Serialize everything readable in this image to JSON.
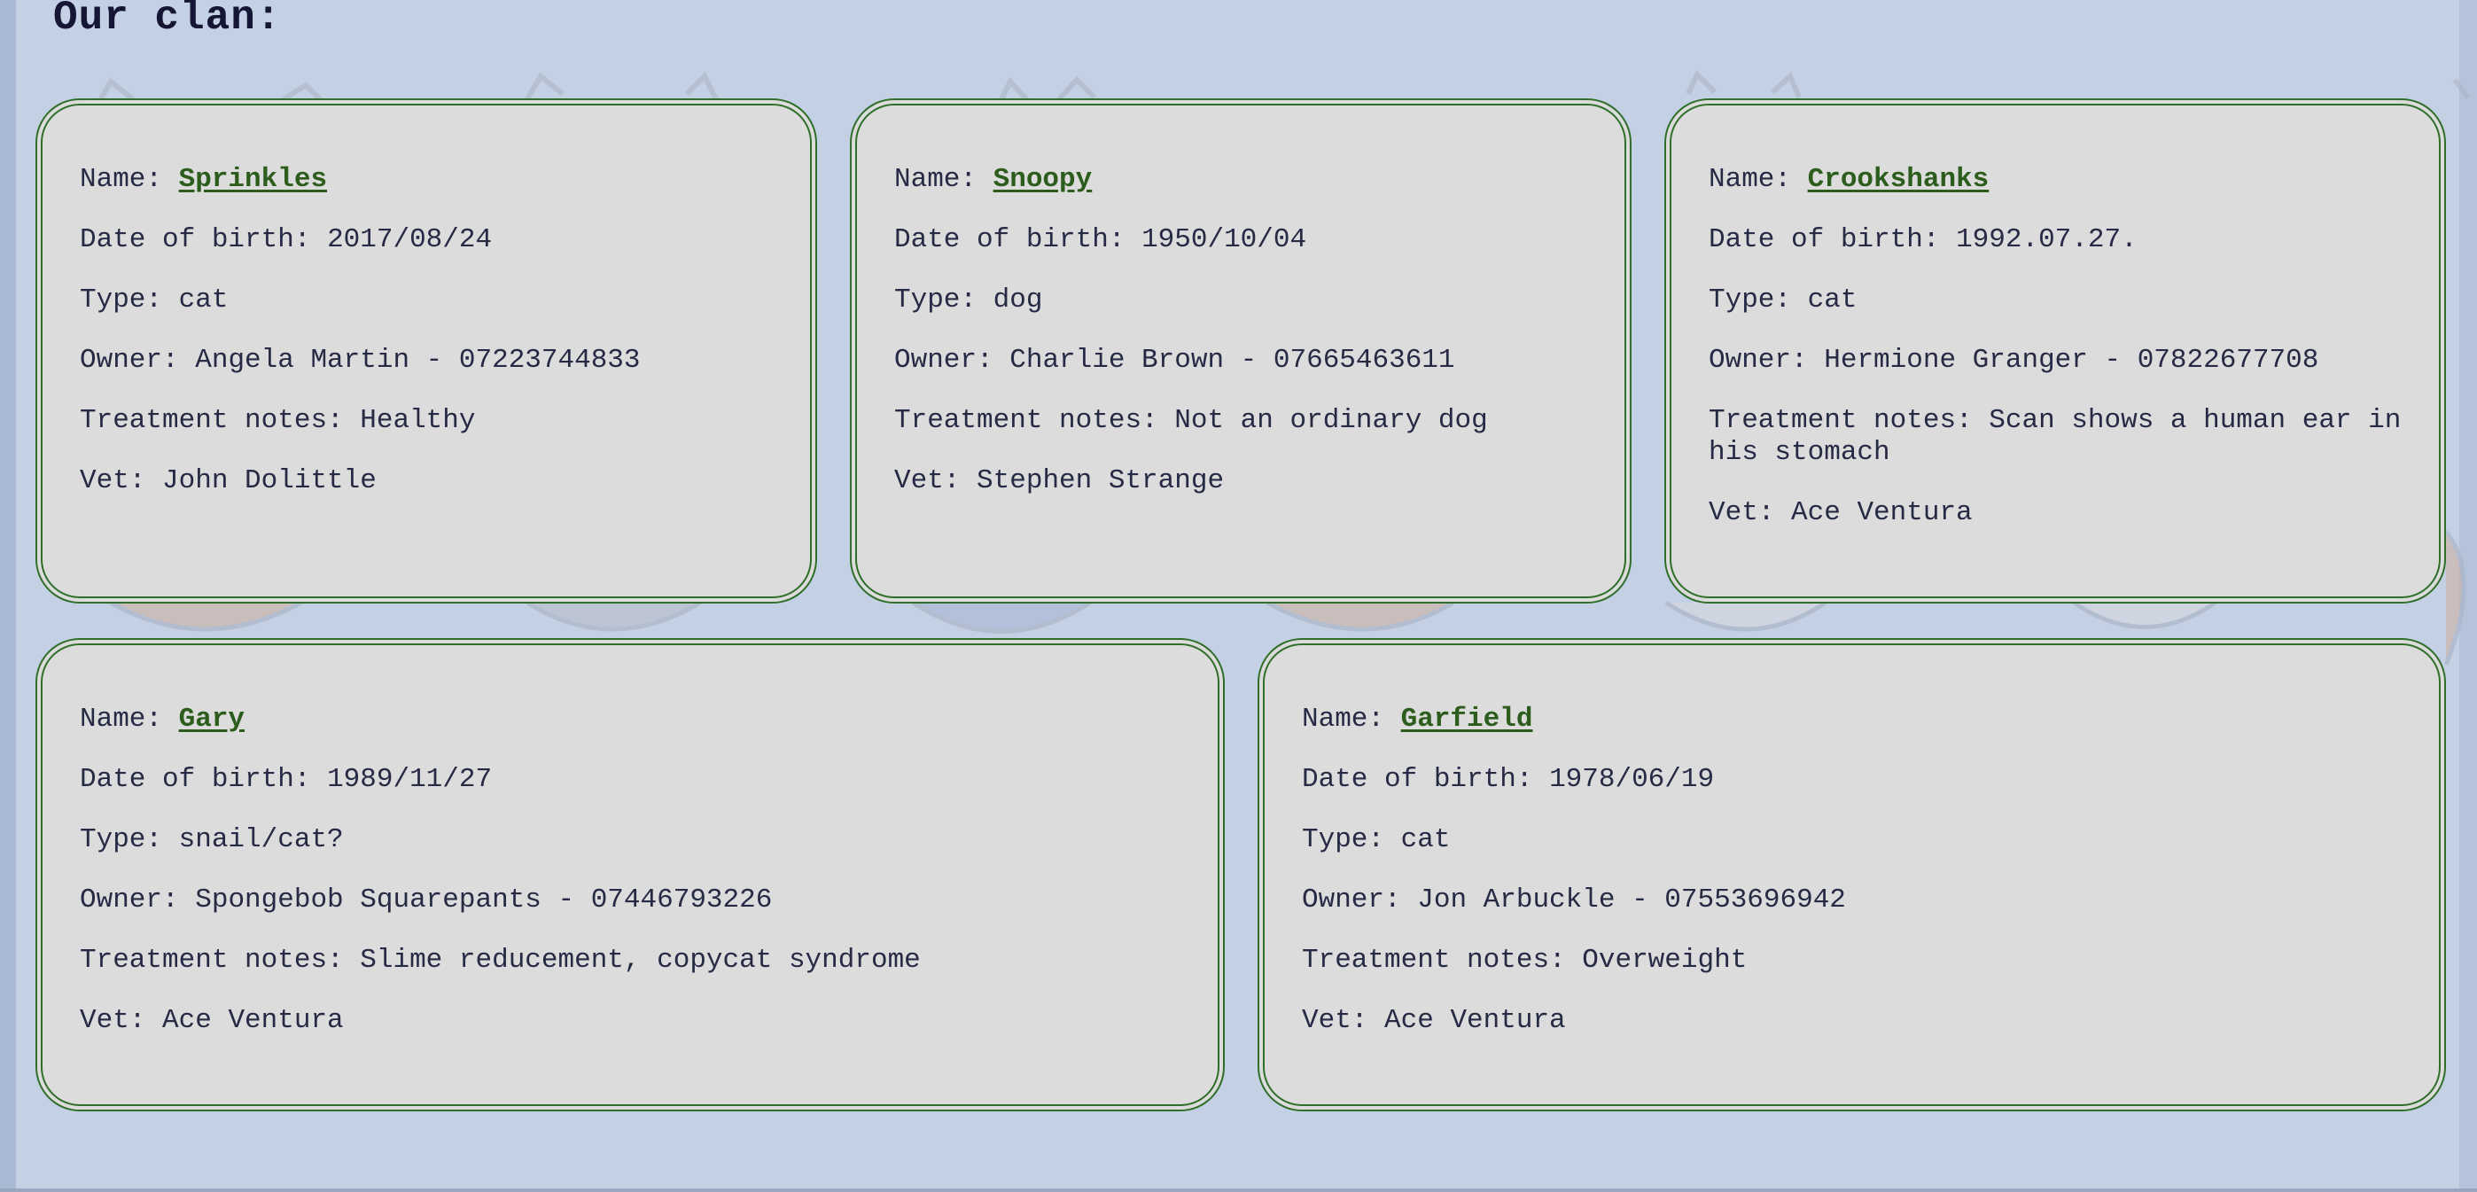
{
  "page": {
    "title": "Our clan:"
  },
  "labels": {
    "name": "Name:",
    "dob": "Date of birth:",
    "type": "Type:",
    "owner": "Owner:",
    "notes": "Treatment notes:",
    "vet": "Vet:"
  },
  "pets": [
    {
      "name": "Sprinkles",
      "dob": "2017/08/24",
      "type": "cat",
      "owner": "Angela Martin - 07223744833",
      "notes": "Healthy",
      "vet": "John Dolittle"
    },
    {
      "name": "Snoopy",
      "dob": "1950/10/04",
      "type": "dog",
      "owner": "Charlie Brown - 07665463611",
      "notes": "Not an ordinary dog",
      "vet": "Stephen Strange"
    },
    {
      "name": "Crookshanks",
      "dob": "1992.07.27.",
      "type": "cat",
      "owner": "Hermione Granger - 07822677708",
      "notes": "Scan shows a human ear in his stomach",
      "vet": "Ace Ventura"
    },
    {
      "name": "Gary",
      "dob": "1989/11/27",
      "type": "snail/cat?",
      "owner": "Spongebob Squarepants - 07446793226",
      "notes": "Slime reducement, copycat syndrome",
      "vet": "Ace Ventura"
    },
    {
      "name": "Garfield",
      "dob": "1978/06/19",
      "type": "cat",
      "owner": "Jon Arbuckle - 07553696942",
      "notes": "Overweight",
      "vet": "Ace Ventura"
    }
  ],
  "colors": {
    "background": "#c4d0e4",
    "card": "#dcdcdc",
    "card_border": "#2f6f2a",
    "link": "#2c5d1c",
    "text": "#272a45"
  }
}
